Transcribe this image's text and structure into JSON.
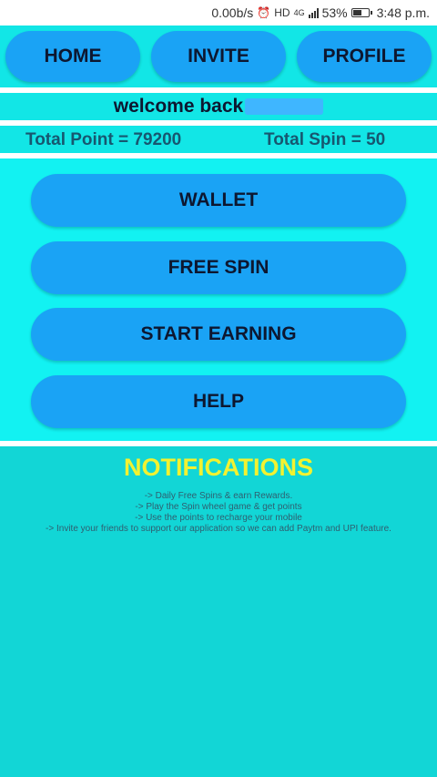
{
  "status_bar": {
    "speed": "0.00b/s",
    "network": "4G",
    "battery": "53%",
    "time": "3:48 p.m."
  },
  "nav": {
    "home": "HOME",
    "invite": "INVITE",
    "profile": "PROFILE"
  },
  "welcome": {
    "text": "welcome back"
  },
  "stats": {
    "total_point": "Total Point = 79200",
    "total_spin": "Total Spin = 50"
  },
  "menu": {
    "wallet": "WALLET",
    "free_spin": "FREE SPIN",
    "start_earning": "START EARNING",
    "help": "HELP"
  },
  "notifications": {
    "title": "NOTIFICATIONS",
    "lines": [
      "-> Daily Free Spins & earn Rewards.",
      "-> Play the Spin wheel game & get points",
      "-> Use the points to recharge your mobile",
      "-> Invite your friends to support our application so we can add Paytm and UPI feature."
    ]
  },
  "colors": {
    "background_cyan": "#12e6e6",
    "button_blue": "#1aa3f5",
    "notification_title": "#f2f230",
    "divider": "#ffffff"
  }
}
